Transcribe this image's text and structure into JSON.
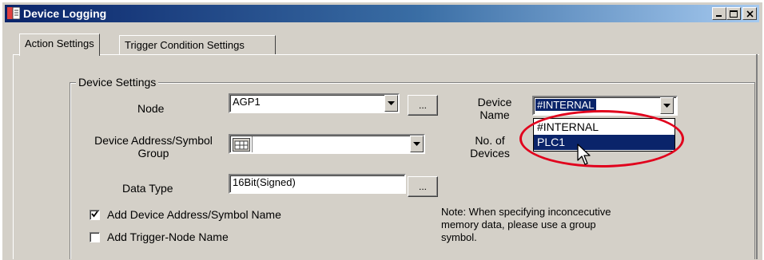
{
  "window": {
    "title": "Device Logging",
    "title_bar_colors": {
      "start": "#0a246a",
      "end": "#a6caf0"
    },
    "controls": {
      "minimize_icon": "minimize-icon",
      "maximize_icon": "maximize-icon",
      "close_icon": "close-icon"
    }
  },
  "tabs": [
    {
      "label": "Action Settings",
      "active": true
    },
    {
      "label": "Trigger Condition Settings",
      "active": false
    }
  ],
  "device_settings": {
    "group_title": "Device Settings",
    "node": {
      "label": "Node",
      "value": "AGP1",
      "browse_label": "..."
    },
    "device_address": {
      "label_line1": "Device Address/Symbol",
      "label_line2": "Group",
      "value": "",
      "icon": "address-table-icon"
    },
    "data_type": {
      "label": "Data Type",
      "value": "16Bit(Signed)",
      "browse_label": "..."
    },
    "device_name": {
      "label_line1": "Device",
      "label_line2": "Name",
      "value": "#INTERNAL",
      "options": [
        "#INTERNAL",
        "PLC1"
      ],
      "hovered_option": "PLC1"
    },
    "no_of_devices": {
      "label_line1": "No. of",
      "label_line2": "Devices"
    },
    "add_device_address": {
      "label": "Add Device Address/Symbol Name",
      "checked": true
    },
    "add_trigger_node": {
      "label": "Add Trigger-Node Name",
      "checked": false
    },
    "note_line1": "Note: When specifying inconcecutive",
    "note_line2": "memory data, please use a group",
    "note_line3": "symbol."
  },
  "colors": {
    "highlight_oval": "#e1001c",
    "selection": "#0a246a",
    "face": "#d4d0c8"
  }
}
